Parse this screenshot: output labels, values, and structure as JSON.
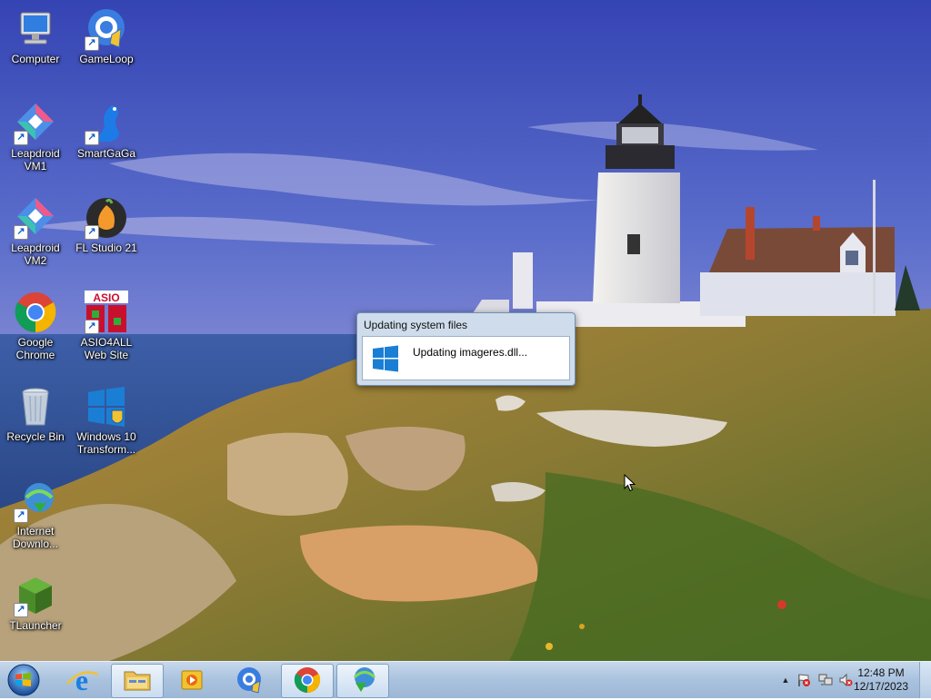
{
  "desktop": {
    "icons": [
      {
        "label": "Computer",
        "icon": "computer-icon"
      },
      {
        "label": "GameLoop",
        "icon": "gameloop-icon"
      },
      {
        "label": "Leapdroid VM1",
        "icon": "leapdroid-icon"
      },
      {
        "label": "SmartGaGa",
        "icon": "smartgaga-icon"
      },
      {
        "label": "Leapdroid VM2",
        "icon": "leapdroid-icon"
      },
      {
        "label": "FL Studio 21",
        "icon": "fl-studio-icon"
      },
      {
        "label": "Google Chrome",
        "icon": "chrome-icon"
      },
      {
        "label": "ASIO4ALL Web Site",
        "icon": "asio4all-icon"
      },
      {
        "label": "Recycle Bin",
        "icon": "recycle-bin-icon"
      },
      {
        "label": "Windows 10 Transform...",
        "icon": "windows-10-icon"
      },
      {
        "label": "Internet Downlo...",
        "icon": "idm-icon"
      },
      {
        "label": "TLauncher",
        "icon": "tlauncher-icon"
      }
    ]
  },
  "dialog": {
    "title": "Updating system files",
    "message": "Updating imageres.dll..."
  },
  "taskbar": {
    "pinned": [
      {
        "name": "internet-explorer",
        "icon": "ie-icon"
      },
      {
        "name": "windows-explorer",
        "icon": "folder-icon"
      },
      {
        "name": "media-player",
        "icon": "media-player-icon"
      },
      {
        "name": "gameloop",
        "icon": "gameloop-icon"
      },
      {
        "name": "google-chrome",
        "icon": "chrome-icon"
      },
      {
        "name": "internet-download-manager",
        "icon": "idm-icon"
      }
    ],
    "clock": {
      "time": "12:48 PM",
      "date": "12/17/2023"
    }
  },
  "colors": {
    "sky_top": "#3a4fb8",
    "sea": "#2b4f9a",
    "taskbar": "#b7cce5",
    "windows_blue": "#1a7fd4"
  }
}
